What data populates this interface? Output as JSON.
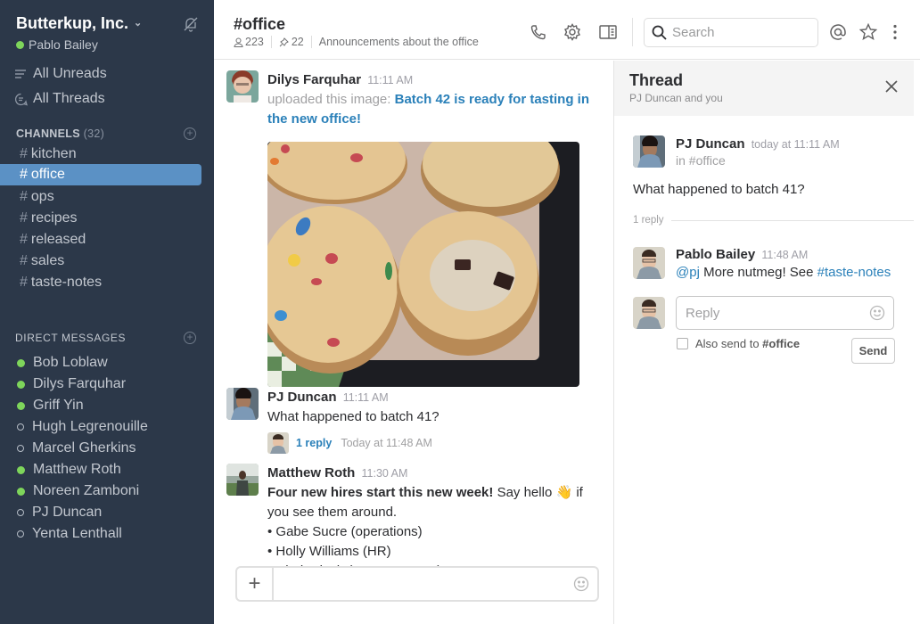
{
  "sidebar": {
    "team_name": "Butterkup, Inc.",
    "current_user": "Pablo Bailey",
    "nav": [
      {
        "label": "All Unreads",
        "icon": "list-icon"
      },
      {
        "label": "All Threads",
        "icon": "threads-icon"
      }
    ],
    "channels_header": "CHANNELS",
    "channels_count": "(32)",
    "channels": [
      {
        "name": "kitchen",
        "active": false
      },
      {
        "name": "office",
        "active": true
      },
      {
        "name": "ops",
        "active": false
      },
      {
        "name": "recipes",
        "active": false
      },
      {
        "name": "released",
        "active": false
      },
      {
        "name": "sales",
        "active": false
      },
      {
        "name": "taste-notes",
        "active": false
      }
    ],
    "dm_header": "DIRECT MESSAGES",
    "direct_messages": [
      {
        "name": "Bob Loblaw",
        "online": true
      },
      {
        "name": "Dilys Farquhar",
        "online": true
      },
      {
        "name": "Griff Yin",
        "online": true
      },
      {
        "name": "Hugh Legrenouille",
        "online": false
      },
      {
        "name": "Marcel Gherkins",
        "online": false
      },
      {
        "name": "Matthew Roth",
        "online": true
      },
      {
        "name": "Noreen Zamboni",
        "online": true
      },
      {
        "name": "PJ Duncan",
        "online": false
      },
      {
        "name": "Yenta Lenthall",
        "online": false
      }
    ]
  },
  "header": {
    "channel_title": "#office",
    "member_count": "223",
    "pinned_count": "22",
    "topic": "Announcements about the office",
    "search_placeholder": "Search"
  },
  "messages": [
    {
      "author": "Dilys Farquhar",
      "time": "11:11 AM",
      "prefix": "uploaded this image:",
      "link": "Batch 42 is ready for tasting in the new office!",
      "image_alt": "cookies-photo"
    },
    {
      "author": "PJ Duncan",
      "time": "11:11 AM",
      "text": "What happened to batch 41?",
      "reply_count": "1 reply",
      "reply_time": "Today at 11:48 AM"
    },
    {
      "author": "Matthew Roth",
      "time": "11:30 AM",
      "bold": "Four new hires start this new week!",
      "text_a": "Say hello",
      "emoji": "👋",
      "text_b": "if you see them around.",
      "bullets": [
        "Gabe Sucre (operations)",
        "Holly Williams (HR)",
        "Clark Kinch (customer care)"
      ]
    }
  ],
  "composer": {
    "placeholder": ""
  },
  "thread": {
    "title": "Thread",
    "subtitle": "PJ Duncan and you",
    "parent": {
      "author": "PJ Duncan",
      "time": "today at 11:11 AM",
      "channel": "in #office",
      "text": "What happened to batch 41?"
    },
    "divider": "1 reply",
    "reply": {
      "author": "Pablo Bailey",
      "time": "11:48 AM",
      "mention": "@pj",
      "text": "More nutmeg! See",
      "channel_link": "#taste-notes"
    },
    "reply_placeholder": "Reply",
    "also_send_prefix": "Also send to",
    "also_send_channel": "#office",
    "send_label": "Send"
  },
  "colors": {
    "sidebar_bg": "#2c3849",
    "active_channel": "#5b91c5",
    "online": "#7ed55b",
    "link": "#2a80b9"
  }
}
